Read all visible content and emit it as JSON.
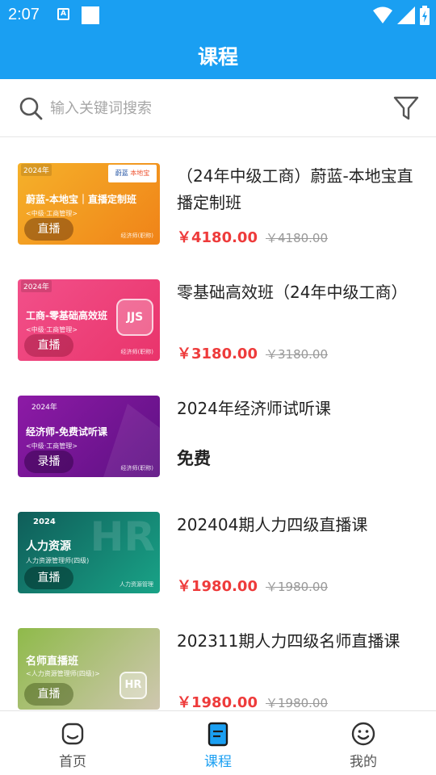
{
  "status": {
    "time": "2:07",
    "a_label": "A"
  },
  "appbar": {
    "title": "课程"
  },
  "search": {
    "placeholder": "输入关键词搜索",
    "value": ""
  },
  "courses": [
    {
      "name": "（24年中级工商）蔚蓝-本地宝直播定制班",
      "price": "￥4180.00",
      "old_price": "￥4180.00",
      "thumb": {
        "year": "2024年",
        "title": "蔚蓝-本地宝｜直播定制班",
        "subtitle": "<中级·工商管理>",
        "tag": "直播",
        "watermark": "经济师(职称)",
        "logo1": "蔚蓝",
        "logo2": "本地宝"
      }
    },
    {
      "name": "零基础高效班（24年中级工商）",
      "price": "￥3180.00",
      "old_price": "￥3180.00",
      "thumb": {
        "year": "2024年",
        "title": "工商-零基础高效班",
        "subtitle": "<中级·工商管理>",
        "tag": "直播",
        "watermark": "经济师(职称)",
        "badge": "JJS"
      }
    },
    {
      "name": "2024年经济师试听课",
      "free": "免费",
      "thumb": {
        "year": "2024年",
        "title": "经济师-免费试听课",
        "subtitle": "<中级·工商管理>",
        "tag": "录播",
        "watermark": "经济师(职称)"
      }
    },
    {
      "name": "202404期人力四级直播课",
      "price": "￥1980.00",
      "old_price": "￥1980.00",
      "thumb": {
        "year": "2024",
        "title": "人力资源",
        "subtitle": "人力资源管理师(四级)",
        "tag": "直播",
        "watermark": "人力资源管理",
        "bg_text": "HR"
      }
    },
    {
      "name": "202311期人力四级名师直播课",
      "price": "￥1980.00",
      "old_price": "￥1980.00",
      "thumb": {
        "title": "名师直播班",
        "subtitle": "<人力资源管理师(四级)>",
        "tag": "直播",
        "badge": "HR"
      }
    }
  ],
  "tabs": [
    {
      "label": "首页",
      "icon": "home-icon",
      "active": false
    },
    {
      "label": "课程",
      "icon": "course-icon",
      "active": true
    },
    {
      "label": "我的",
      "icon": "smile-icon",
      "active": false
    }
  ],
  "colors": {
    "primary": "#1a9ff2",
    "price": "#ee3b3b"
  }
}
